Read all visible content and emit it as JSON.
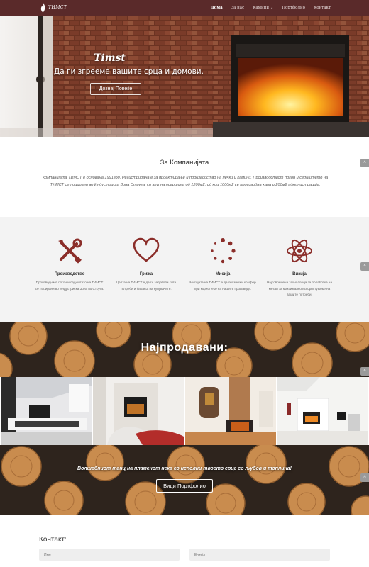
{
  "nav": {
    "brand": "ТИМСТ",
    "items": [
      {
        "label": "Дома",
        "active": true
      },
      {
        "label": "За нас",
        "active": false
      },
      {
        "label": "Камини",
        "active": false,
        "dropdown": true
      },
      {
        "label": "Портфолио",
        "active": false
      },
      {
        "label": "Контакт",
        "active": false
      }
    ],
    "color": "#5a2a2a"
  },
  "hero": {
    "title": "Timst",
    "subtitle": "Да ги згрееме вашите срца и домови.",
    "button": "Дознај Повеќе"
  },
  "about": {
    "title": "За Компанијата",
    "text": "Компанијата ТИМСТ е основана 1991год. Регистрирана е за проектирање и производство на печки и камини. Производствот погон и седиштето на ТИМСТ се лоцирани во Индустриска Зона Струга, со вкупна површина од 1200м2, од кои 1000м2 се производна хала и 200м2 администрација."
  },
  "features": [
    {
      "icon": "tools-icon",
      "title": "Производство",
      "text": "Производниот погон и седиштето на ТИМСТ се лоцирани во Индустриска Зона во Струга."
    },
    {
      "icon": "heart-icon",
      "title": "Грижа",
      "text": "Целта на ТИМСТ е да ги задоволи сите потреби и барања на купувачите."
    },
    {
      "icon": "loading-icon",
      "title": "Мисија",
      "text": "Мисијата на ТИМСТ е да овозможи комфор при користење на нашите производи."
    },
    {
      "icon": "atom-icon",
      "title": "Визија",
      "text": "Најсовремена технологија за обработка на метал за максимално искористување на вашите потреби."
    }
  ],
  "bestsellers": {
    "title": "Најпродавани:"
  },
  "cta": {
    "text": "Волшебниот танц на пламенот нека го исполни твоето срце со љубов и топлина!",
    "button": "Види Портфолио"
  },
  "contact": {
    "title": "Контакт:",
    "name_placeholder": "Име",
    "email_placeholder": "Е-мејл"
  },
  "colors": {
    "accent": "#8b2e2a",
    "nav": "#5a2a2a"
  }
}
